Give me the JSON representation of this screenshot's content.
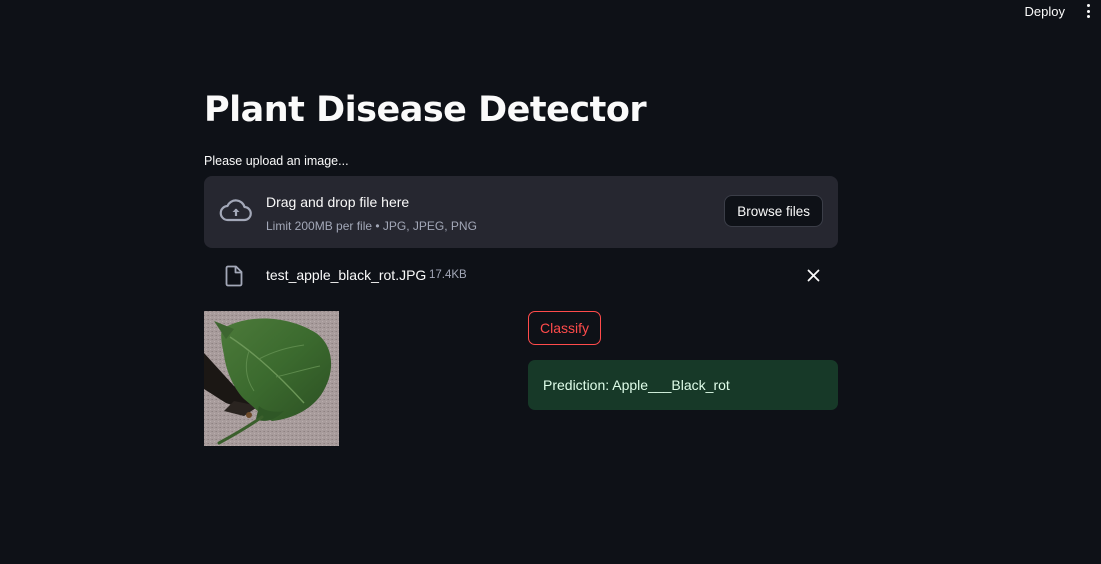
{
  "header": {
    "deploy_label": "Deploy",
    "menu_icon": "more-vertical-icon"
  },
  "main": {
    "title": "Plant Disease Detector",
    "upload_label": "Please upload an image..."
  },
  "uploader": {
    "icon": "cloud-upload-icon",
    "title": "Drag and drop file here",
    "subtitle": "Limit 200MB per file • JPG, JPEG, PNG",
    "browse_label": "Browse files"
  },
  "file": {
    "icon": "file-icon",
    "name": "test_apple_black_rot.JPG",
    "size": "17.4KB",
    "remove_icon": "close-icon"
  },
  "image": {
    "description_icon": "leaf-image"
  },
  "actions": {
    "classify_label": "Classify"
  },
  "result": {
    "text": "Prediction: Apple___Black_rot"
  },
  "colors": {
    "background": "#0e1117",
    "dropzone": "#262730",
    "accent": "#ff4b4b",
    "success_bg": "#173928",
    "success_text": "#dffde9"
  }
}
